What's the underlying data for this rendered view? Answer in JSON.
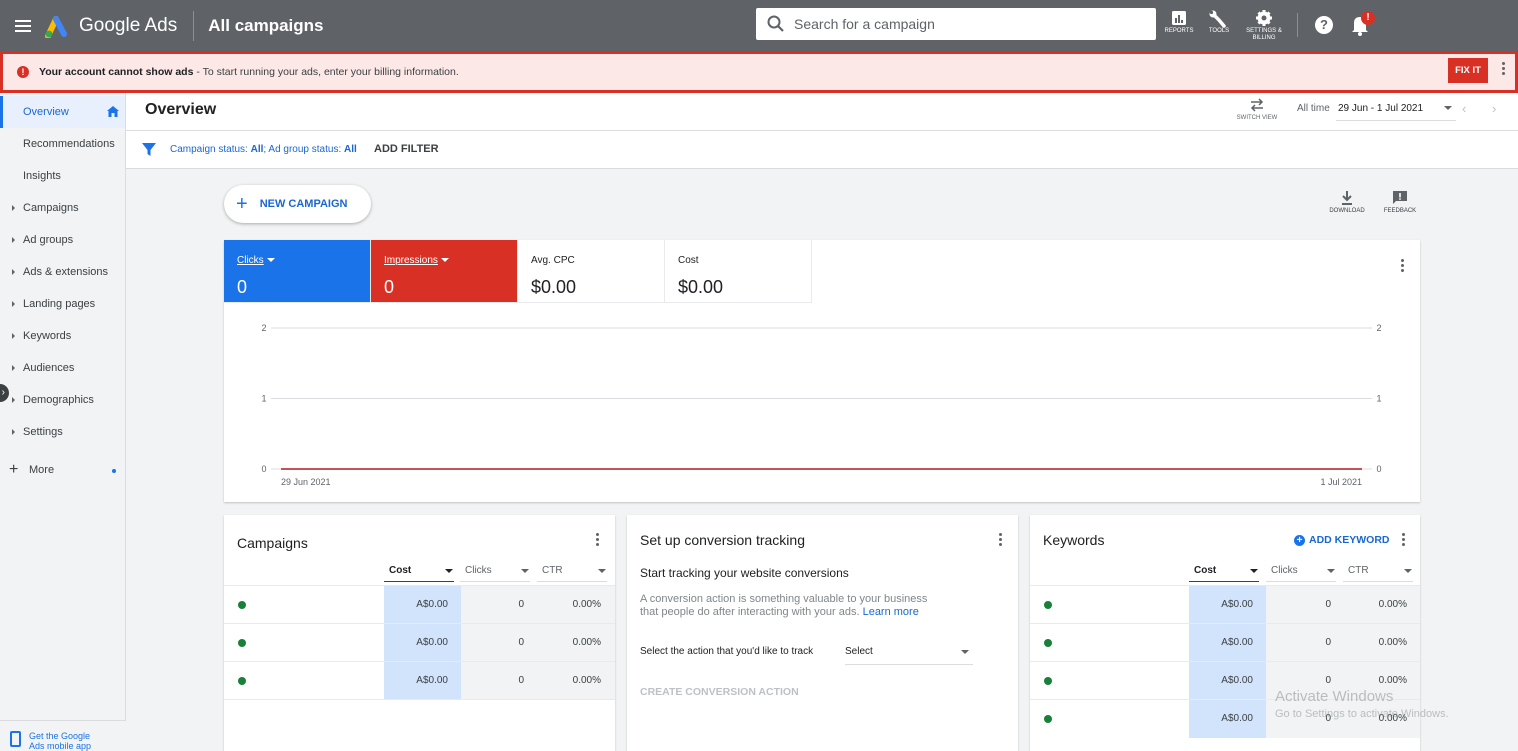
{
  "app": {
    "brand": "Google Ads",
    "section": "All campaigns",
    "search_placeholder": "Search for a campaign",
    "toolbar": [
      {
        "label": "REPORTS",
        "icon": "reports-icon"
      },
      {
        "label": "TOOLS",
        "icon": "wrench-icon"
      },
      {
        "label": "SETTINGS & BILLING",
        "icon": "gear-icon"
      }
    ],
    "help_glyph": "?",
    "notification_badge": "!"
  },
  "alert": {
    "bold": "Your account cannot show ads",
    "text": " - To start running your ads, enter your billing information.",
    "button": "FIX IT",
    "color": "#d93025"
  },
  "sidebar": {
    "items": [
      {
        "label": "Overview",
        "active": true
      },
      {
        "label": "Recommendations"
      },
      {
        "label": "Insights"
      },
      {
        "label": "Campaigns",
        "expandable": true
      },
      {
        "label": "Ad groups",
        "expandable": true
      },
      {
        "label": "Ads & extensions",
        "expandable": true
      },
      {
        "label": "Landing pages",
        "expandable": true
      },
      {
        "label": "Keywords",
        "expandable": true
      },
      {
        "label": "Audiences",
        "expandable": true
      },
      {
        "label": "Demographics",
        "expandable": true
      },
      {
        "label": "Settings",
        "expandable": true
      }
    ],
    "more": "More",
    "mobile_app_line1": "Get the Google",
    "mobile_app_line2": "Ads mobile app"
  },
  "header": {
    "title": "Overview",
    "switch_view": "SWITCH VIEW",
    "date_label": "All time",
    "date_range": "29 Jun - 1 Jul 2021"
  },
  "filters": {
    "campaign_status_label": "Campaign status: ",
    "campaign_status_value": "All",
    "ad_group_status_label": "; Ad group status: ",
    "ad_group_status_value": "All",
    "add_filter": "ADD FILTER"
  },
  "actions": {
    "new_campaign": "NEW CAMPAIGN",
    "download": "DOWNLOAD",
    "feedback": "FEEDBACK"
  },
  "metrics": [
    {
      "label": "Clicks",
      "value": "0",
      "color": "#1a73e8"
    },
    {
      "label": "Impressions",
      "value": "0",
      "color": "#d93025"
    },
    {
      "label": "Avg. CPC",
      "value": "$0.00"
    },
    {
      "label": "Cost",
      "value": "$0.00"
    }
  ],
  "chart_data": {
    "type": "line",
    "x": [
      "29 Jun 2021",
      "1 Jul 2021"
    ],
    "x_tick_labels": [
      "29 Jun 2021",
      "1 Jul 2021"
    ],
    "series": [
      {
        "name": "Clicks",
        "values": [
          0,
          0
        ],
        "color": "#1a73e8"
      },
      {
        "name": "Impressions",
        "values": [
          0,
          0
        ],
        "color": "#d93025"
      }
    ],
    "y_ticks_left": [
      "0",
      "1",
      "2"
    ],
    "y_ticks_right": [
      "0",
      "1",
      "2"
    ],
    "ylim": [
      0,
      2
    ],
    "grid": true
  },
  "campaigns_card": {
    "title": "Campaigns",
    "columns": [
      "Cost",
      "Clicks",
      "CTR"
    ],
    "rows": [
      {
        "cost": "A$0.00",
        "clicks": "0",
        "ctr": "0.00%"
      },
      {
        "cost": "A$0.00",
        "clicks": "0",
        "ctr": "0.00%"
      },
      {
        "cost": "A$0.00",
        "clicks": "0",
        "ctr": "0.00%"
      }
    ]
  },
  "conversion_card": {
    "title": "Set up conversion tracking",
    "subtitle": "Start tracking your website conversions",
    "description": "A conversion action is something valuable to your business that people do after interacting with your ads. ",
    "learn_more": "Learn more",
    "question": "Select the action that you'd like to track",
    "select_value": "Select",
    "create_button": "CREATE CONVERSION ACTION"
  },
  "keywords_card": {
    "title": "Keywords",
    "add_button": "ADD KEYWORD",
    "columns": [
      "Cost",
      "Clicks",
      "CTR"
    ],
    "rows": [
      {
        "cost": "A$0.00",
        "clicks": "0",
        "ctr": "0.00%"
      },
      {
        "cost": "A$0.00",
        "clicks": "0",
        "ctr": "0.00%"
      },
      {
        "cost": "A$0.00",
        "clicks": "0",
        "ctr": "0.00%"
      },
      {
        "cost": "A$0.00",
        "clicks": "0",
        "ctr": "0.00%"
      }
    ]
  },
  "watermark": {
    "line1": "Activate Windows",
    "line2": "Go to Settings to activate Windows."
  }
}
